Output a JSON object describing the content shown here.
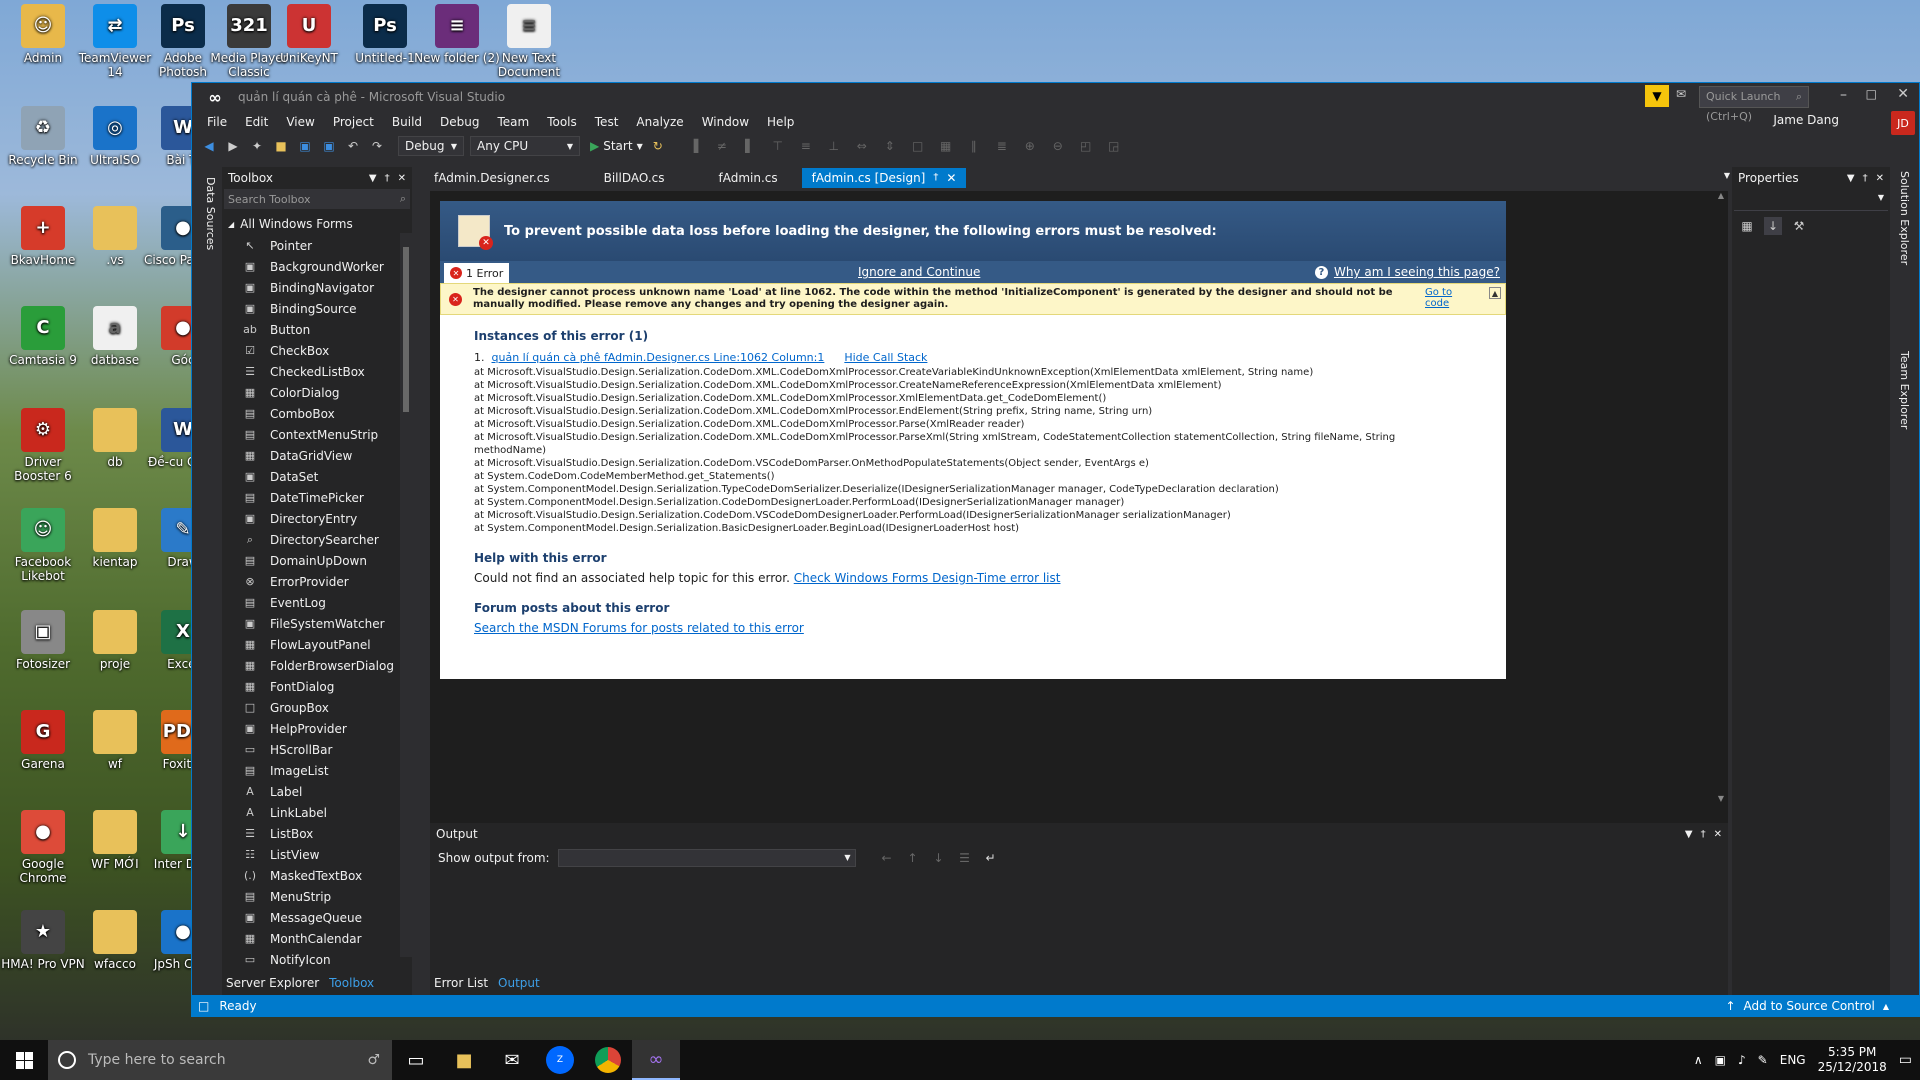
{
  "desktop": {
    "icons": [
      {
        "label": "Admin",
        "color": "#e8b84a",
        "glyph": "☺"
      },
      {
        "label": "TeamViewer 14",
        "color": "#0e8ee9",
        "glyph": "⇄"
      },
      {
        "label": "Adobe Photosh",
        "color": "#0b2c4a",
        "glyph": "Ps"
      },
      {
        "label": "Media Player Classic",
        "color": "#3a3a3a",
        "glyph": "321"
      },
      {
        "label": "UniKeyNT",
        "color": "#cc3333",
        "glyph": "U"
      },
      {
        "label": "Untitled-1",
        "color": "#0b2c4a",
        "glyph": "Ps"
      },
      {
        "label": "New folder (2)",
        "color": "#6b2d7a",
        "glyph": "≡"
      },
      {
        "label": "New Text Document",
        "color": "#f0f0f0",
        "glyph": "≡"
      },
      {
        "label": "Recycle Bin",
        "color": "#8fa3b5",
        "glyph": "♻"
      },
      {
        "label": "UltraISO",
        "color": "#1a73c9",
        "glyph": "◎"
      },
      {
        "label": "Bài Tr",
        "color": "#2b579a",
        "glyph": "W"
      },
      {
        "label": "BkavHome",
        "color": "#d63b2a",
        "glyph": "+"
      },
      {
        "label": ".vs",
        "color": "#e8c15a",
        "glyph": ""
      },
      {
        "label": "Cisco Pa Trac",
        "color": "#2b5e8a",
        "glyph": "●"
      },
      {
        "label": "Camtasia 9",
        "color": "#2a9d3a",
        "glyph": "C"
      },
      {
        "label": "datbase",
        "color": "#f0f0f0",
        "glyph": "a"
      },
      {
        "label": "Góc",
        "color": "#d23b2a",
        "glyph": "●"
      },
      {
        "label": "Driver Booster 6",
        "color": "#c9281d",
        "glyph": "⚙"
      },
      {
        "label": "db",
        "color": "#e8c15a",
        "glyph": ""
      },
      {
        "label": "Đề-cu Quốc",
        "color": "#2b579a",
        "glyph": "W"
      },
      {
        "label": "Facebook Likebot",
        "color": "#3aa55a",
        "glyph": "☺"
      },
      {
        "label": "kientap",
        "color": "#e8c15a",
        "glyph": ""
      },
      {
        "label": "Draw",
        "color": "#2b7ac9",
        "glyph": "✎"
      },
      {
        "label": "Fotosizer",
        "color": "#888888",
        "glyph": "▣"
      },
      {
        "label": "proje",
        "color": "#e8c15a",
        "glyph": ""
      },
      {
        "label": "Excel",
        "color": "#1e7145",
        "glyph": "X"
      },
      {
        "label": "Garena",
        "color": "#c9281d",
        "glyph": "G"
      },
      {
        "label": "wf",
        "color": "#e8c15a",
        "glyph": ""
      },
      {
        "label": "Foxit R",
        "color": "#e06a1b",
        "glyph": "PDF"
      },
      {
        "label": "Google Chrome",
        "color": "#dd4b39",
        "glyph": "●"
      },
      {
        "label": "WF MỚI",
        "color": "#e8c15a",
        "glyph": ""
      },
      {
        "label": "Inter Dow",
        "color": "#3aa55a",
        "glyph": "↓"
      },
      {
        "label": "HMA! Pro VPN",
        "color": "#444444",
        "glyph": "★"
      },
      {
        "label": "wfacco",
        "color": "#e8c15a",
        "glyph": ""
      },
      {
        "label": "JpSh Chro",
        "color": "#1a73c9",
        "glyph": "●"
      }
    ]
  },
  "window": {
    "title": "quản lí quán cà phê - Microsoft Visual Studio",
    "quick_launch_placeholder": "Quick Launch (Ctrl+Q)",
    "user_name": "Jame Dang",
    "user_initials": "JD",
    "accent": "#007acc"
  },
  "menu": [
    "File",
    "Edit",
    "View",
    "Project",
    "Build",
    "Debug",
    "Team",
    "Tools",
    "Test",
    "Analyze",
    "Window",
    "Help"
  ],
  "toolbar": {
    "config": "Debug",
    "platform": "Any CPU",
    "start_label": "Start"
  },
  "side_strip_left": {
    "label": "Data Sources"
  },
  "toolbox": {
    "title": "Toolbox",
    "search_placeholder": "Search Toolbox",
    "group": "All Windows Forms",
    "items": [
      {
        "label": "Pointer",
        "icon": "↖"
      },
      {
        "label": "BackgroundWorker",
        "icon": "▣"
      },
      {
        "label": "BindingNavigator",
        "icon": "▣"
      },
      {
        "label": "BindingSource",
        "icon": "▣"
      },
      {
        "label": "Button",
        "icon": "ab"
      },
      {
        "label": "CheckBox",
        "icon": "☑"
      },
      {
        "label": "CheckedListBox",
        "icon": "☰"
      },
      {
        "label": "ColorDialog",
        "icon": "▦"
      },
      {
        "label": "ComboBox",
        "icon": "▤"
      },
      {
        "label": "ContextMenuStrip",
        "icon": "▤"
      },
      {
        "label": "DataGridView",
        "icon": "▦"
      },
      {
        "label": "DataSet",
        "icon": "▣"
      },
      {
        "label": "DateTimePicker",
        "icon": "▤"
      },
      {
        "label": "DirectoryEntry",
        "icon": "▣"
      },
      {
        "label": "DirectorySearcher",
        "icon": "⌕"
      },
      {
        "label": "DomainUpDown",
        "icon": "▤"
      },
      {
        "label": "ErrorProvider",
        "icon": "⊗"
      },
      {
        "label": "EventLog",
        "icon": "▤"
      },
      {
        "label": "FileSystemWatcher",
        "icon": "▣"
      },
      {
        "label": "FlowLayoutPanel",
        "icon": "▦"
      },
      {
        "label": "FolderBrowserDialog",
        "icon": "▦"
      },
      {
        "label": "FontDialog",
        "icon": "▦"
      },
      {
        "label": "GroupBox",
        "icon": "□"
      },
      {
        "label": "HelpProvider",
        "icon": "▣"
      },
      {
        "label": "HScrollBar",
        "icon": "▭"
      },
      {
        "label": "ImageList",
        "icon": "▤"
      },
      {
        "label": "Label",
        "icon": "A"
      },
      {
        "label": "LinkLabel",
        "icon": "A"
      },
      {
        "label": "ListBox",
        "icon": "☰"
      },
      {
        "label": "ListView",
        "icon": "☷"
      },
      {
        "label": "MaskedTextBox",
        "icon": "(.)"
      },
      {
        "label": "MenuStrip",
        "icon": "▤"
      },
      {
        "label": "MessageQueue",
        "icon": "▣"
      },
      {
        "label": "MonthCalendar",
        "icon": "▦"
      },
      {
        "label": "NotifyIcon",
        "icon": "▭"
      }
    ],
    "bottom_tabs": [
      "Server Explorer",
      "Toolbox"
    ]
  },
  "doc_tabs": [
    "fAdmin.Designer.cs",
    "BillDAO.cs",
    "fAdmin.cs",
    "fAdmin.cs [Design]"
  ],
  "designer_error": {
    "header": "To prevent possible data loss before loading the designer, the following errors must be resolved:",
    "error_count": "1 Error",
    "ignore_link": "Ignore and Continue",
    "why_link": "Why am I seeing this page?",
    "message": "The designer cannot process unknown name 'Load' at line 1062. The code within the method 'InitializeComponent' is generated by the designer and should not be manually modified. Please remove any changes and try opening the designer again.",
    "goto_code": "Go to code",
    "instances_title": "Instances of this error (1)",
    "instance_num": "1.",
    "instance_link": "quản lí quán cà phê fAdmin.Designer.cs Line:1062 Column:1",
    "hide_stack": "Hide Call Stack",
    "stack": [
      "at Microsoft.VisualStudio.Design.Serialization.CodeDom.XML.CodeDomXmlProcessor.CreateVariableKindUnknownException(XmlElementData xmlElement, String name)",
      "at Microsoft.VisualStudio.Design.Serialization.CodeDom.XML.CodeDomXmlProcessor.CreateNameReferenceExpression(XmlElementData xmlElement)",
      "at Microsoft.VisualStudio.Design.Serialization.CodeDom.XML.CodeDomXmlProcessor.XmlElementData.get_CodeDomElement()",
      "at Microsoft.VisualStudio.Design.Serialization.CodeDom.XML.CodeDomXmlProcessor.EndElement(String prefix, String name, String urn)",
      "at Microsoft.VisualStudio.Design.Serialization.CodeDom.XML.CodeDomXmlProcessor.Parse(XmlReader reader)",
      "at Microsoft.VisualStudio.Design.Serialization.CodeDom.XML.CodeDomXmlProcessor.ParseXml(String xmlStream, CodeStatementCollection statementCollection, String fileName, String methodName)",
      "at Microsoft.VisualStudio.Design.Serialization.CodeDom.VSCodeDomParser.OnMethodPopulateStatements(Object sender, EventArgs e)",
      "at System.CodeDom.CodeMemberMethod.get_Statements()",
      "at System.ComponentModel.Design.Serialization.TypeCodeDomSerializer.Deserialize(IDesignerSerializationManager manager, CodeTypeDeclaration declaration)",
      "at System.ComponentModel.Design.Serialization.CodeDomDesignerLoader.PerformLoad(IDesignerSerializationManager manager)",
      "at Microsoft.VisualStudio.Design.Serialization.CodeDom.VSCodeDomDesignerLoader.PerformLoad(IDesignerSerializationManager serializationManager)",
      "at System.ComponentModel.Design.Serialization.BasicDesignerLoader.BeginLoad(IDesignerLoaderHost host)"
    ],
    "help_title": "Help with this error",
    "help_text": "Could not find an associated help topic for this error.",
    "help_link": "Check Windows Forms Design-Time error list",
    "forum_title": "Forum posts about this error",
    "forum_link": "Search the MSDN Forums for posts related to this error"
  },
  "output": {
    "title": "Output",
    "show_from_label": "Show output from:",
    "bottom_tabs": [
      "Error List",
      "Output"
    ]
  },
  "properties": {
    "title": "Properties"
  },
  "side_strip_right": [
    "Solution Explorer",
    "Team Explorer"
  ],
  "statusbar": {
    "status": "Ready",
    "source_control": "Add to Source Control"
  },
  "taskbar": {
    "search_placeholder": "Type here to search",
    "lang": "ENG",
    "time": "5:35 PM",
    "date": "25/12/2018"
  }
}
